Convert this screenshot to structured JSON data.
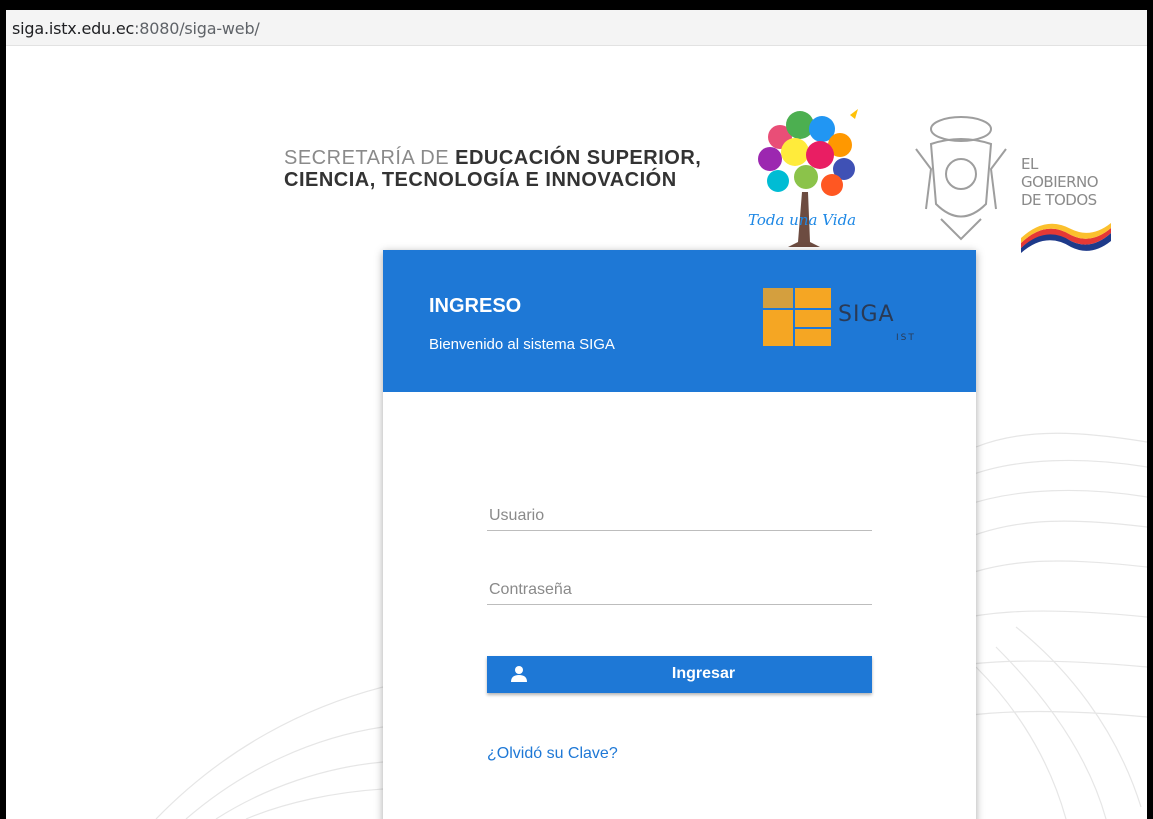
{
  "browser": {
    "url_host": "siga.istx.edu.ec",
    "url_rest": ":8080/siga-web/"
  },
  "header": {
    "secretaria_line1_light": "SECRETARÍA DE ",
    "secretaria_line1_bold": "EDUCACIÓN SUPERIOR,",
    "secretaria_line2": "CIENCIA, TECNOLOGÍA E INNOVACIÓN",
    "tree_logo_text": "Toda una Vida",
    "gobierno_line1": "EL",
    "gobierno_line2": "GOBIERNO",
    "gobierno_line3": "DE TODOS"
  },
  "login": {
    "title": "INGRESO",
    "subtitle": "Bienvenido al sistema SIGA",
    "logo_text": "SIGA",
    "logo_subtext": "IST",
    "username_placeholder": "Usuario",
    "password_placeholder": "Contraseña",
    "submit_label": "Ingresar",
    "forgot_link": "¿Olvidó su Clave?"
  },
  "colors": {
    "primary": "#1e78d6",
    "siga_orange": "#f5a623"
  },
  "icons": {
    "submit_icon": "user-icon"
  }
}
